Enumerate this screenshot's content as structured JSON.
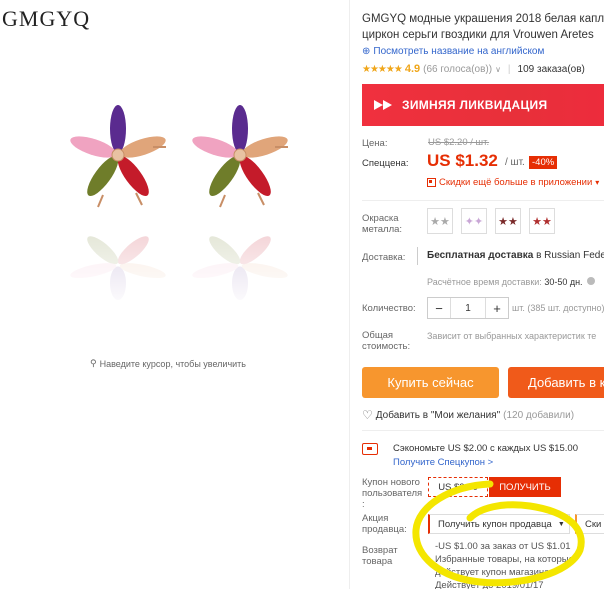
{
  "gallery": {
    "logo": "GMGYQ",
    "zoom_hint": "Наведите курсор, чтобы увеличить"
  },
  "product": {
    "title_line1": "GMGYQ модные украшения 2018 белая капл",
    "title_line2": "циркон серьги гвоздики для Vrouwen Aretes",
    "translate_link": "Посмотреть название на английском",
    "rating_stars": "★★★★★",
    "rating_score": "4.9",
    "rating_votes": "(66 голоса(ов))",
    "orders": "109 заказа(ов)"
  },
  "banner": {
    "text": "ЗИМНЯЯ ЛИКВИДАЦИЯ"
  },
  "price": {
    "old_label": "Цена:",
    "old_value": "US $2.20 / шт.",
    "new_label": "Спеццена:",
    "new_value": "US $1.32",
    "unit": "/ шт.",
    "discount": "-40%",
    "app_discount": "Скидки ещё больше в приложении"
  },
  "options": {
    "metal_label_1": "Окраска",
    "metal_label_2": "металла:",
    "swatches": [
      "★★",
      "✦✦",
      "★★",
      "★★"
    ]
  },
  "shipping": {
    "label": "Доставка:",
    "text_bold": "Бесплатная доставка",
    "text_rest": " в Russian Federa",
    "time_label": "Расчётное время доставки:",
    "time_value": "30-50 дн."
  },
  "quantity": {
    "label": "Количество:",
    "value": "1",
    "minus": "−",
    "plus": "+",
    "note": "шт. (385 шт. доступно)"
  },
  "total": {
    "label_1": "Общая",
    "label_2": "стоимость:",
    "value": "Зависит от выбранных характеристик те"
  },
  "actions": {
    "buy": "Купить сейчас",
    "cart": "Добавить в к",
    "wishlist": "Добавить в \"Мои желания\"",
    "wishlist_count": "(120 добавили)"
  },
  "promo": {
    "save_line": "Сэкономьте US $2.00 с каждых US $15.00",
    "get_code": "Получите Спецкупон >",
    "newuser_label_1": "Купон нового",
    "newuser_label_2": "пользователя",
    "newuser_label_3": ":",
    "coupon_value": "US $2.00",
    "coupon_button": "ПОЛУЧИТЬ",
    "seller_label_1": "Акция",
    "seller_label_2": "продавца:",
    "seller_select": "Получить купон продавца",
    "seller_extra": "Ски",
    "seller_desc_1": "-US $1.00 за заказ от US $1.01",
    "seller_desc_2": "Избранные товары, на которые",
    "seller_desc_3": "действует купон магазина",
    "seller_desc_4": "Действует до 2019/01/17",
    "return_label_1": "Возврат",
    "return_label_2": "товара"
  },
  "colors": {
    "accent": "#e62e04",
    "buy": "#f7962e",
    "cart": "#f05a1a",
    "link": "#3366cc",
    "highlight": "#f4e600"
  }
}
